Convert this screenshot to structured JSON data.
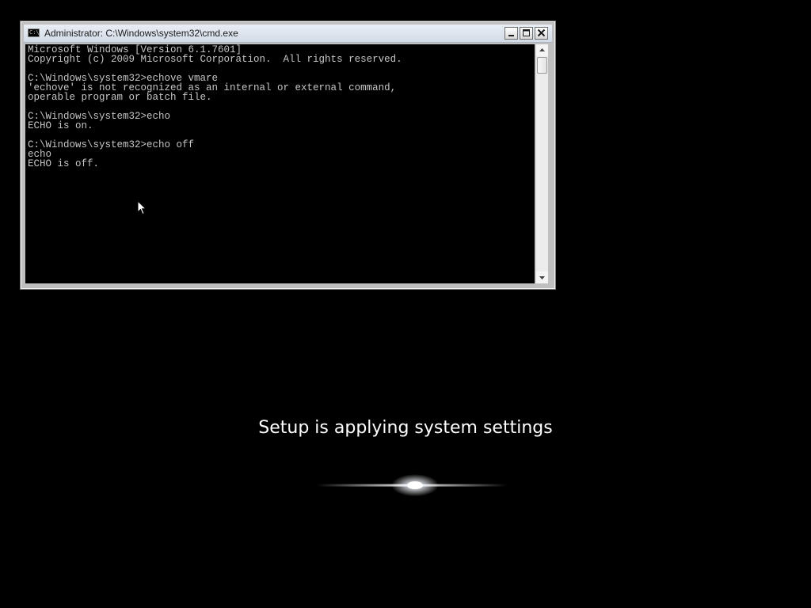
{
  "window": {
    "title": "Administrator: C:\\Windows\\system32\\cmd.exe",
    "icon": "cmd-icon",
    "icon_glyph": "C:\\",
    "buttons": [
      "minimize-icon",
      "maximize-icon",
      "close-icon"
    ]
  },
  "console": {
    "lines": [
      "Microsoft Windows [Version 6.1.7601]",
      "Copyright (c) 2009 Microsoft Corporation.  All rights reserved.",
      "",
      "C:\\Windows\\system32>echove vmare",
      "'echove' is not recognized as an internal or external command,",
      "operable program or batch file.",
      "",
      "C:\\Windows\\system32>echo",
      "ECHO is on.",
      "",
      "C:\\Windows\\system32>echo off",
      "echo",
      "ECHO is off."
    ],
    "text_color": "#c6c6c6",
    "background": "#000000"
  },
  "setup": {
    "status": "Setup is applying system settings"
  },
  "colors": {
    "desktop_background": "#000000",
    "status_text": "#ffffff"
  }
}
